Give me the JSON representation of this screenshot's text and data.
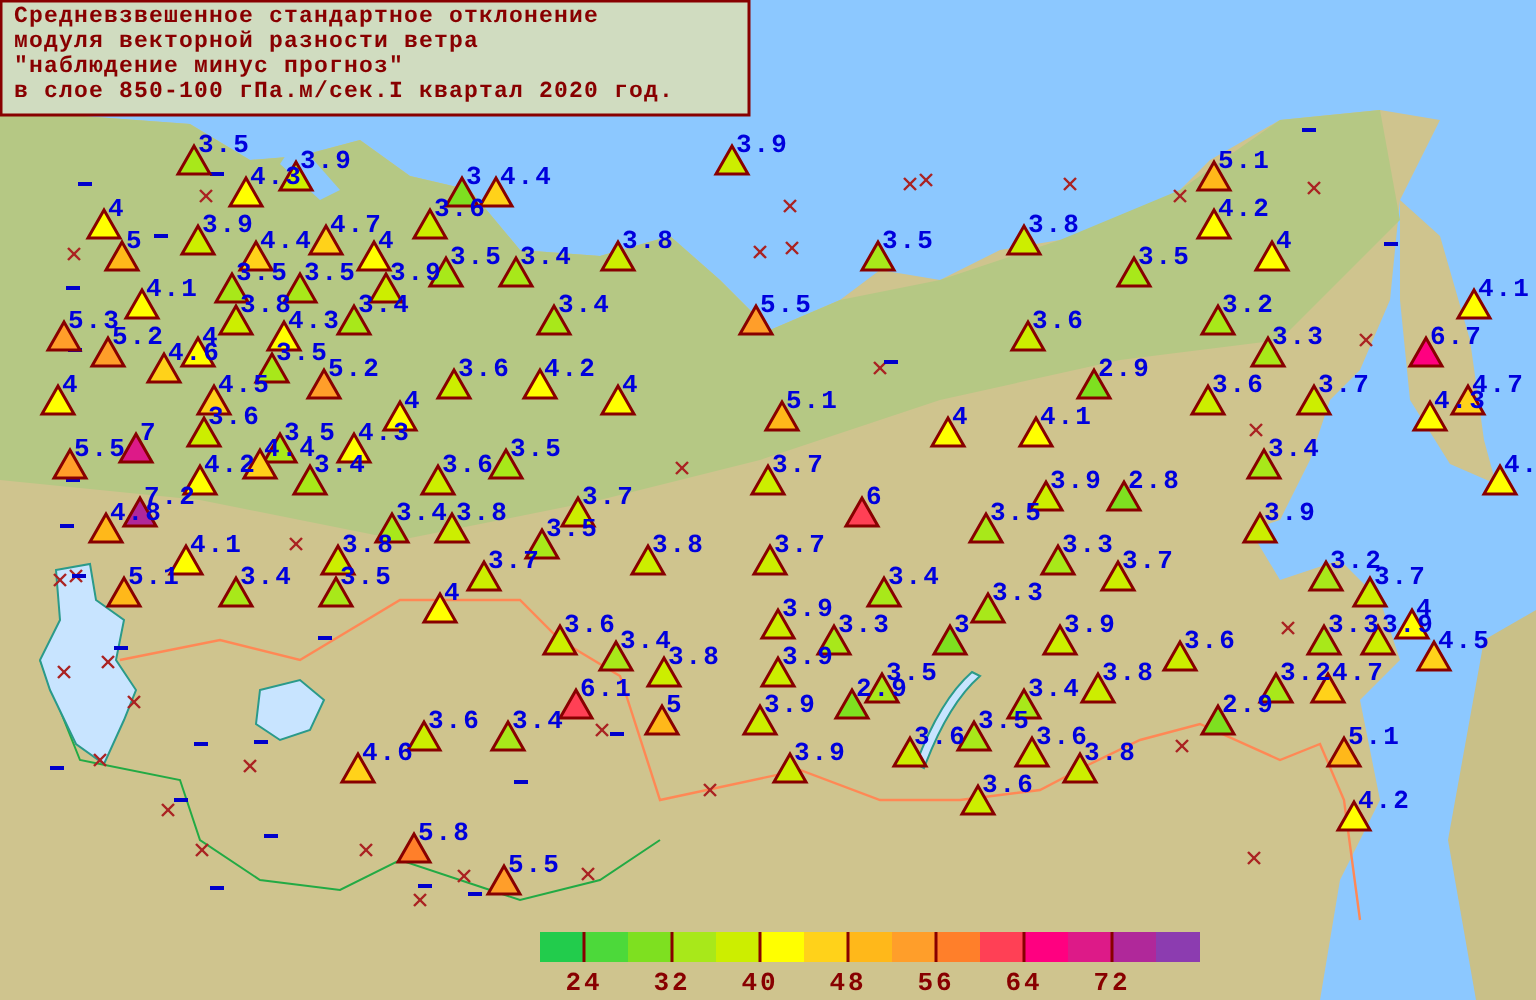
{
  "title": {
    "lines": [
      "Средневзвешенное стандартное отклонение",
      "модуля векторной разности ветра",
      "\"наблюдение минус прогноз\"",
      "в слое 850-100 гПа.м/сек.I квартал 2020 год."
    ]
  },
  "stations": [
    {
      "value": "3.5",
      "color": "#a8e81a"
    },
    {
      "value": "3.9",
      "color": "#ccee00"
    },
    {
      "value": "3.9",
      "color": "#ccee00"
    },
    {
      "value": "5.1",
      "color": "#ffb81a"
    },
    {
      "value": "4.3",
      "color": "#ffff00"
    },
    {
      "value": "3",
      "color": "#7ee020"
    },
    {
      "value": "4.4",
      "color": "#ffd21a"
    },
    {
      "value": "4",
      "color": "#ffff00"
    },
    {
      "value": "3.6",
      "color": "#ccee00"
    },
    {
      "value": "4.2",
      "color": "#ffff00"
    },
    {
      "value": "3.9",
      "color": "#ccee00"
    },
    {
      "value": "4.7",
      "color": "#ffd21a"
    },
    {
      "value": "3.8",
      "color": "#ccee00"
    },
    {
      "value": "5",
      "color": "#ffb81a"
    },
    {
      "value": "4.4",
      "color": "#ffd21a"
    },
    {
      "value": "4",
      "color": "#ffff00"
    },
    {
      "value": "3.8",
      "color": "#ccee00"
    },
    {
      "value": "3.5",
      "color": "#a8e81a"
    },
    {
      "value": "4",
      "color": "#ffff00"
    },
    {
      "value": "3.5",
      "color": "#a8e81a"
    },
    {
      "value": "3.4",
      "color": "#a8e81a"
    },
    {
      "value": "3.5",
      "color": "#a8e81a"
    },
    {
      "value": "3.5",
      "color": "#a8e81a"
    },
    {
      "value": "3.5",
      "color": "#a8e81a"
    },
    {
      "value": "3.9",
      "color": "#ccee00"
    },
    {
      "value": "4.1",
      "color": "#ffff00"
    },
    {
      "value": "4.1",
      "color": "#ffff00"
    },
    {
      "value": "3.8",
      "color": "#ccee00"
    },
    {
      "value": "3.4",
      "color": "#a8e81a"
    },
    {
      "value": "3.4",
      "color": "#a8e81a"
    },
    {
      "value": "5.5",
      "color": "#ff9e2a"
    },
    {
      "value": "3.2",
      "color": "#a8e81a"
    },
    {
      "value": "5.3",
      "color": "#ff9e2a"
    },
    {
      "value": "4.3",
      "color": "#ffff00"
    },
    {
      "value": "3.6",
      "color": "#ccee00"
    },
    {
      "value": "5.2",
      "color": "#ff9e2a"
    },
    {
      "value": "4",
      "color": "#ffff00"
    },
    {
      "value": "3.3",
      "color": "#a8e81a"
    },
    {
      "value": "6.7",
      "color": "#ff0080"
    },
    {
      "value": "4.6",
      "color": "#ffd21a"
    },
    {
      "value": "3.5",
      "color": "#a8e81a"
    },
    {
      "value": "5.2",
      "color": "#ff9e2a"
    },
    {
      "value": "3.6",
      "color": "#ccee00"
    },
    {
      "value": "4.2",
      "color": "#ffff00"
    },
    {
      "value": "2.9",
      "color": "#7ee020"
    },
    {
      "value": "4",
      "color": "#ffff00"
    },
    {
      "value": "4.5",
      "color": "#ffd21a"
    },
    {
      "value": "4",
      "color": "#ffff00"
    },
    {
      "value": "3.6",
      "color": "#ccee00"
    },
    {
      "value": "3.7",
      "color": "#ccee00"
    },
    {
      "value": "4.7",
      "color": "#ffd21a"
    },
    {
      "value": "4",
      "color": "#ffff00"
    },
    {
      "value": "5.1",
      "color": "#ffb81a"
    },
    {
      "value": "4.3",
      "color": "#ffff00"
    },
    {
      "value": "3.6",
      "color": "#ccee00"
    },
    {
      "value": "4",
      "color": "#ffff00"
    },
    {
      "value": "4.1",
      "color": "#ffff00"
    },
    {
      "value": "7",
      "color": "#dd1a88"
    },
    {
      "value": "3.5",
      "color": "#a8e81a"
    },
    {
      "value": "4.3",
      "color": "#ffff00"
    },
    {
      "value": "5.5",
      "color": "#ff9e2a"
    },
    {
      "value": "4.4",
      "color": "#ffd21a"
    },
    {
      "value": "3.5",
      "color": "#a8e81a"
    },
    {
      "value": "3.4",
      "color": "#a8e81a"
    },
    {
      "value": "4.2",
      "color": "#ffff00"
    },
    {
      "value": "3.4",
      "color": "#a8e81a"
    },
    {
      "value": "3.6",
      "color": "#ccee00"
    },
    {
      "value": "3.7",
      "color": "#ccee00"
    },
    {
      "value": "4.",
      "color": "#ffff00"
    },
    {
      "value": "3.9",
      "color": "#ccee00"
    },
    {
      "value": "2.8",
      "color": "#7ee020"
    },
    {
      "value": "7.2",
      "color": "#b0289a"
    },
    {
      "value": "3.7",
      "color": "#ccee00"
    },
    {
      "value": "6",
      "color": "#ff4055"
    },
    {
      "value": "4.8",
      "color": "#ffb81a"
    },
    {
      "value": "3.4",
      "color": "#a8e81a"
    },
    {
      "value": "3.8",
      "color": "#ccee00"
    },
    {
      "value": "3.5",
      "color": "#a8e81a"
    },
    {
      "value": "3.9",
      "color": "#ccee00"
    },
    {
      "value": "3.5",
      "color": "#a8e81a"
    },
    {
      "value": "4.1",
      "color": "#ffff00"
    },
    {
      "value": "3.8",
      "color": "#ccee00"
    },
    {
      "value": "3.8",
      "color": "#ccee00"
    },
    {
      "value": "3.7",
      "color": "#ccee00"
    },
    {
      "value": "3.3",
      "color": "#a8e81a"
    },
    {
      "value": "3.7",
      "color": "#ccee00"
    },
    {
      "value": "3.7",
      "color": "#ccee00"
    },
    {
      "value": "3.2",
      "color": "#a8e81a"
    },
    {
      "value": "5.1",
      "color": "#ffb81a"
    },
    {
      "value": "3.4",
      "color": "#a8e81a"
    },
    {
      "value": "3.5",
      "color": "#a8e81a"
    },
    {
      "value": "3.4",
      "color": "#a8e81a"
    },
    {
      "value": "3.7",
      "color": "#ccee00"
    },
    {
      "value": "4",
      "color": "#ffff00"
    },
    {
      "value": "3.3",
      "color": "#a8e81a"
    },
    {
      "value": "3.9",
      "color": "#ccee00"
    },
    {
      "value": "4",
      "color": "#ffff00"
    },
    {
      "value": "3.6",
      "color": "#ccee00"
    },
    {
      "value": "3.3",
      "color": "#a8e81a"
    },
    {
      "value": "3",
      "color": "#7ee020"
    },
    {
      "value": "3.9",
      "color": "#ccee00"
    },
    {
      "value": "3.3",
      "color": "#a8e81a"
    },
    {
      "value": "3.9",
      "color": "#ccee00"
    },
    {
      "value": "3.4",
      "color": "#a8e81a"
    },
    {
      "value": "3.6",
      "color": "#ccee00"
    },
    {
      "value": "4.5",
      "color": "#ffd21a"
    },
    {
      "value": "3.8",
      "color": "#ccee00"
    },
    {
      "value": "3.9",
      "color": "#ccee00"
    },
    {
      "value": "3.5",
      "color": "#a8e81a"
    },
    {
      "value": "3.8",
      "color": "#ccee00"
    },
    {
      "value": "3.2",
      "color": "#a8e81a"
    },
    {
      "value": "4.7",
      "color": "#ffd21a"
    },
    {
      "value": "6.1",
      "color": "#ff4055"
    },
    {
      "value": "2.9",
      "color": "#7ee020"
    },
    {
      "value": "3.4",
      "color": "#a8e81a"
    },
    {
      "value": "5",
      "color": "#ffb81a"
    },
    {
      "value": "3.9",
      "color": "#ccee00"
    },
    {
      "value": "2.9",
      "color": "#7ee020"
    },
    {
      "value": "3.6",
      "color": "#ccee00"
    },
    {
      "value": "3.4",
      "color": "#a8e81a"
    },
    {
      "value": "3.5",
      "color": "#a8e81a"
    },
    {
      "value": "3.6",
      "color": "#ccee00"
    },
    {
      "value": "3.6",
      "color": "#ccee00"
    },
    {
      "value": "5.1",
      "color": "#ffb81a"
    },
    {
      "value": "4.6",
      "color": "#ffd21a"
    },
    {
      "value": "3.9",
      "color": "#ccee00"
    },
    {
      "value": "3.8",
      "color": "#ccee00"
    },
    {
      "value": "3.6",
      "color": "#ccee00"
    },
    {
      "value": "4.2",
      "color": "#ffff00"
    },
    {
      "value": "5.8",
      "color": "#ff7f2a"
    },
    {
      "value": "5.5",
      "color": "#ff9e2a"
    }
  ],
  "legend": {
    "swatches": [
      {
        "color": "#22cc4c"
      },
      {
        "color": "#4cd93a"
      },
      {
        "color": "#7ee020"
      },
      {
        "color": "#a8e81a"
      },
      {
        "color": "#ccee00"
      },
      {
        "color": "#ffff00"
      },
      {
        "color": "#ffd21a"
      },
      {
        "color": "#ffb81a"
      },
      {
        "color": "#ff9e2a"
      },
      {
        "color": "#ff7f2a"
      },
      {
        "color": "#ff4055"
      },
      {
        "color": "#ff0080"
      },
      {
        "color": "#dd1a88"
      },
      {
        "color": "#b0289a"
      },
      {
        "color": "#8c3cb0"
      }
    ],
    "labels": [
      "24",
      "32",
      "40",
      "48",
      "56",
      "64",
      "72"
    ]
  }
}
